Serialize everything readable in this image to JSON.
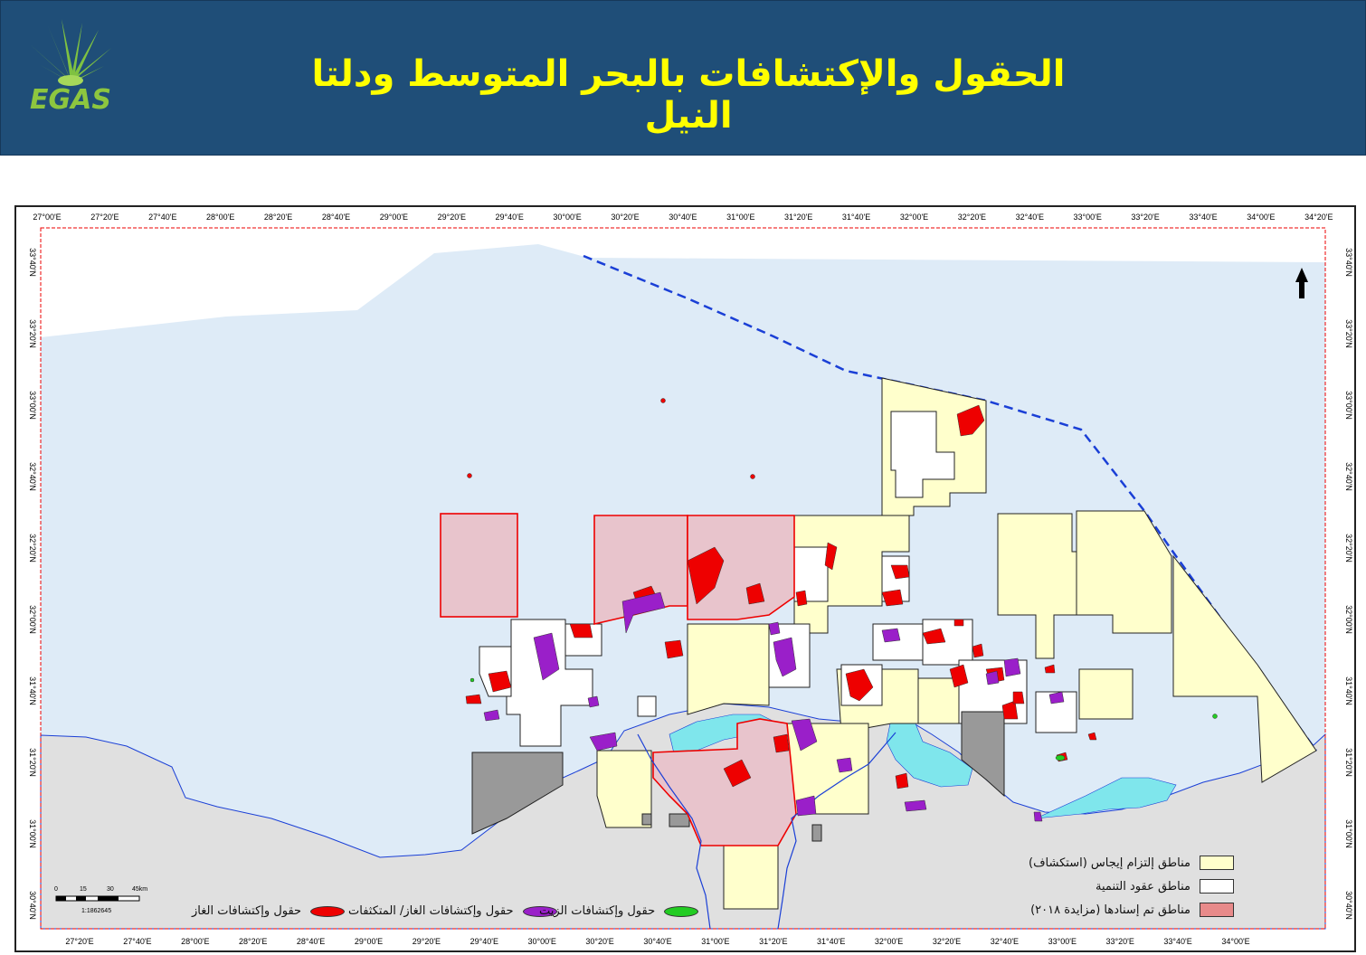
{
  "header": {
    "title": "الحقول والإكتشافات بالبحر المتوسط ودلتا النيل",
    "logo_text": "EGAS",
    "bg_color": "#1f4e78",
    "title_color": "#ffff00"
  },
  "map": {
    "lon_labels_top": [
      "27°00'E",
      "27°20'E",
      "27°40'E",
      "28°00'E",
      "28°20'E",
      "28°40'E",
      "29°00'E",
      "29°20'E",
      "29°40'E",
      "30°00'E",
      "30°20'E",
      "30°40'E",
      "31°00'E",
      "31°20'E",
      "31°40'E",
      "32°00'E",
      "32°20'E",
      "32°40'E",
      "33°00'E",
      "33°20'E",
      "33°40'E",
      "34°00'E",
      "34°20'E"
    ],
    "lon_labels_bottom": [
      "27°20'E",
      "27°40'E",
      "28°00'E",
      "28°20'E",
      "28°40'E",
      "29°00'E",
      "29°20'E",
      "29°40'E",
      "30°00'E",
      "30°20'E",
      "30°40'E",
      "31°00'E",
      "31°20'E",
      "31°40'E",
      "32°00'E",
      "32°20'E",
      "32°40'E",
      "33°00'E",
      "33°20'E",
      "33°40'E",
      "34°00'E"
    ],
    "lat_labels_left": [
      "33°40'N",
      "33°20'N",
      "33°00'N",
      "32°40'N",
      "32°20'N",
      "32°00'N",
      "31°40'N",
      "31°20'N",
      "31°00'N",
      "30°40'N"
    ],
    "lat_labels_right": [
      "33°40'N",
      "33°20'N",
      "33°00'N",
      "32°40'N",
      "32°20'N",
      "32°00'N",
      "31°40'N",
      "31°20'N",
      "31°00'N",
      "30°40'N"
    ],
    "colors": {
      "sea": "#deebf7",
      "land": "#e0e0e0",
      "lake": "#7fe6ec",
      "concession": "#ffffcc",
      "awarded": "#e8c4cc",
      "gas": "#ee0000",
      "oil": "#9a1fc9",
      "condensate": "#22cc22",
      "grey_block": "#999999",
      "boundary": "#1a3fd6"
    }
  },
  "scale": {
    "ticks": [
      "0",
      "15",
      "30",
      "45km"
    ],
    "ratio": "1:1862645"
  },
  "legend": {
    "concession": "مناطق إلتزام إيجاس (استكشاف)",
    "development": "مناطق عقود التنمية",
    "awarded": "مناطق تم إسنادها (مزايدة ٢٠١٨)",
    "gas_fields": "حقول وإكتشافات الغاز",
    "oil_gas_fields": "حقول وإكتشافات الغاز/ المتكثفات",
    "oil_fields": "حقول وإكتشافات الزيت",
    "condensate_fields": "حقول وإكتشافات الزيت"
  }
}
